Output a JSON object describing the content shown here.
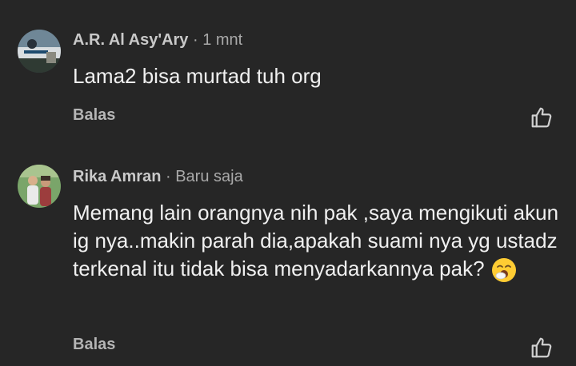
{
  "comments": [
    {
      "author": "A.R. Al Asy'Ary",
      "separator": " · ",
      "time": "1 mnt",
      "text": "Lama2 bisa murtad tuh org",
      "reply_label": "Balas",
      "avatar_icon": "profile-photo-landscape"
    },
    {
      "author": "Rika Amran",
      "separator": " · ",
      "time": "Baru saja",
      "text": "Memang lain orangnya nih pak ,saya mengikuti akun ig nya..makin parah dia,apakah suami nya yg ustadz terkenal itu tidak bisa menyadarkannya pak?",
      "emoji": "yawning-face-emoji",
      "reply_label": "Balas",
      "avatar_icon": "profile-photo-couple"
    }
  ],
  "colors": {
    "background": "#262626",
    "text": "#f0f0f0",
    "muted": "#a9a9a9"
  },
  "icons": {
    "like": "thumbs-up-icon"
  }
}
